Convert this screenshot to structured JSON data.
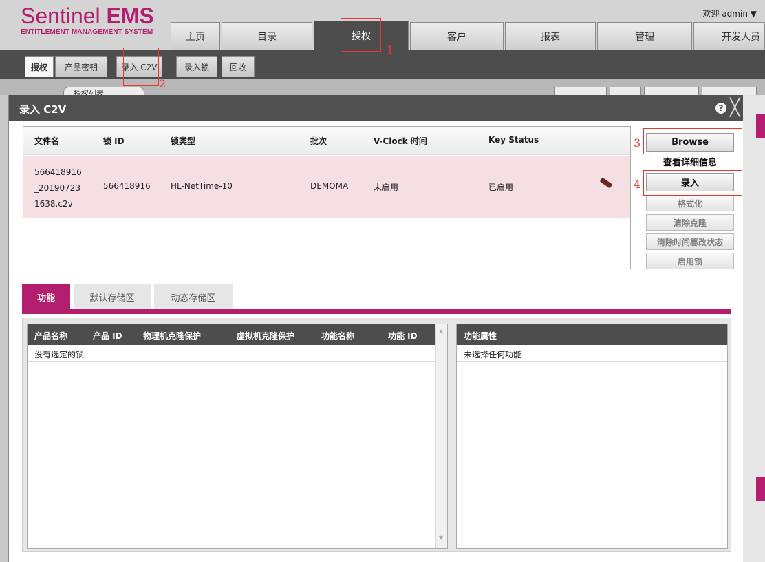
{
  "brand": {
    "name_light": "Sentinel ",
    "name_bold": "EMS",
    "subtitle": "ENTITLEMENT MANAGEMENT SYSTEM"
  },
  "user": {
    "greeting": "欢迎 admin",
    "caret": "▼"
  },
  "main_tabs": [
    "主页",
    "目录",
    "授权",
    "客户",
    "报表",
    "管理",
    "开发人员"
  ],
  "sub_tabs": [
    "授权",
    "产品密钥",
    "录入 C2V",
    "录入锁",
    "回收"
  ],
  "background": {
    "left_button": "授权列表"
  },
  "dialog": {
    "title": "录入 C2V",
    "help_glyph": "?",
    "close_glyph": "╳",
    "columns": [
      "文件名",
      "锁 ID",
      "锁类型",
      "批次",
      "V-Clock 时间",
      "Key Status"
    ],
    "row": {
      "file_lines": [
        "566418916",
        "_20190723",
        "1638.c2v"
      ],
      "lock_id": "566418916",
      "lock_type": "HL-NetTime-10",
      "batch": "DEMOMA",
      "vclock": "未启用",
      "key_status": "已启用",
      "key_icon": "usb-key-icon"
    },
    "side_buttons": {
      "browse": "Browse",
      "view_details": "查看详细信息",
      "import": "录入",
      "format": "格式化",
      "clear_clone": "清除克隆",
      "clear_time_tamper": "清除时间篡改状态",
      "enable_lock": "启用锁"
    },
    "lower_tabs": [
      "功能",
      "默认存储区",
      "动态存储区"
    ],
    "feature_columns": [
      "产品名称",
      "产品 ID",
      "物理机克隆保护",
      "虚拟机克隆保护",
      "功能名称",
      "功能 ID"
    ],
    "feature_empty": "没有选定的锁",
    "attr_column": "功能属性",
    "attr_empty": "未选择任何功能"
  },
  "annotations": [
    "1",
    "2",
    "3",
    "4"
  ],
  "colors": {
    "accent": "#b31f6e",
    "dark_bar": "#4d4d4d",
    "selected_row": "#f6dfe3",
    "annotation": "#e33333"
  }
}
